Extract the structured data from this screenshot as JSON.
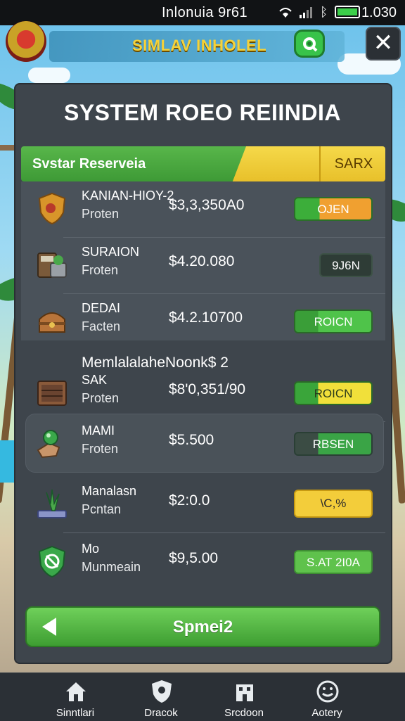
{
  "status_bar": {
    "title": "Inlonuia 9r61",
    "time": "1.030"
  },
  "header": {
    "app_title": "SIMLAV INHOLEL",
    "search_icon": "search-icon",
    "close_label": "✕"
  },
  "panel": {
    "title": "SYSTEM ROEO REIINDIA",
    "section_label": "Svstar Reserveia",
    "section_right": "SARX"
  },
  "items": [
    {
      "icon": "shield-icon",
      "name": "KANIAN-HIOY-2",
      "sub": "Proten",
      "price": "$3,3,350A0",
      "button": "OJEN"
    },
    {
      "icon": "cash-register-icon",
      "name": "SURAION",
      "sub": "Froten",
      "price": "$4.20.080",
      "button": "9J6N"
    },
    {
      "icon": "treasure-chest-icon",
      "name": "DEDAI",
      "sub": "Facten",
      "price": "$4.2.10700",
      "button": "ROICN"
    },
    {
      "icon": "safe-box-icon",
      "name": "SAK",
      "sub": "Proten",
      "price": "$8'0,351/90",
      "button": "ROICN"
    },
    {
      "icon": "hand-orb-icon",
      "name": "MAMI",
      "sub": "Froten",
      "price": "$5.500",
      "button": "RBSEN"
    },
    {
      "icon": "plant-icon",
      "name": "Manalasn",
      "sub": "Pcntan",
      "price": "$2:0.0",
      "button": "\\C,%"
    },
    {
      "icon": "shield-badge-icon",
      "name": "Mo",
      "sub": "Munmeain",
      "price": "$9,5.00",
      "button": "S.AT 2I0A"
    }
  ],
  "group_title": "MemlalalaheNoonk$ 2",
  "primary_button": "Spmei2",
  "nav": [
    {
      "icon": "home-icon",
      "label": "Sinntlari"
    },
    {
      "icon": "shield-nav-icon",
      "label": "Dracok"
    },
    {
      "icon": "building-icon",
      "label": "Srcdoon"
    },
    {
      "icon": "smiley-icon",
      "label": "Aotery"
    }
  ],
  "colors": {
    "accent_green": "#4fc34a",
    "accent_yellow": "#f3cd3a",
    "panel": "#3e454c"
  }
}
